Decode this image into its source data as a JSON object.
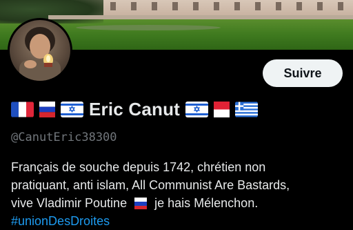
{
  "profile": {
    "display_name": "Eric Canut",
    "handle": "@CanutEric38300",
    "follow_label": "Suivre",
    "flags_before_name": [
      "france-flag",
      "russia-flag",
      "israel-flag"
    ],
    "flags_after_name": [
      "israel-flag",
      "monaco-flag",
      "greece-flag"
    ],
    "bio": {
      "line1": "Français de souche depuis 1742, chrétien non",
      "line2": "pratiquant, anti islam, All Communist Are Bastards,",
      "line3_before_flag": "vive Vladimir Poutine",
      "line3_flag": "russia-flag",
      "line3_after_flag": "je hais Mélenchon.",
      "hashtag": "#unionDesDroites"
    }
  },
  "colors": {
    "background": "#000000",
    "text": "#e7e9ea",
    "muted": "#71767b",
    "link": "#1d9bf0",
    "button_bg": "#eff3f4",
    "button_text": "#0f1419"
  }
}
